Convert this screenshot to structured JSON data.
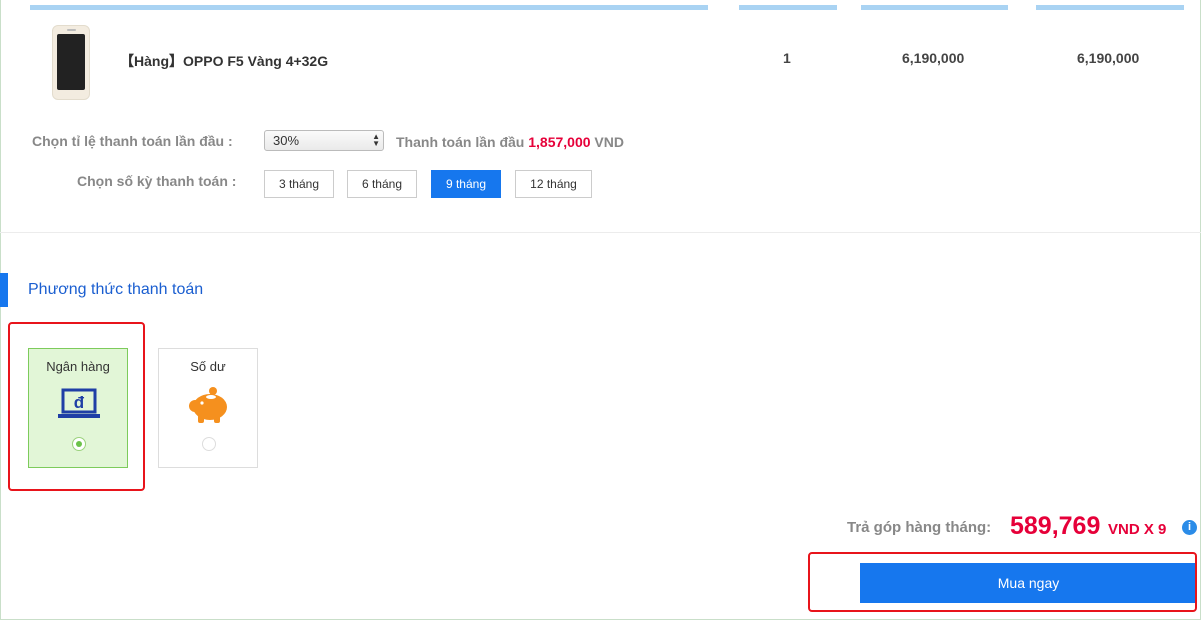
{
  "product": {
    "name": "【Hàng】OPPO F5 Vàng 4+32G",
    "quantity": "1",
    "unit_price": "6,190,000",
    "total": "6,190,000"
  },
  "installment": {
    "down_ratio_label": "Chọn tỉ lệ thanh toán lần đầu :",
    "down_ratio_value": "30%",
    "down_payment_label": "Thanh toán lần đầu",
    "down_payment_amount": "1,857,000",
    "down_payment_unit": "VND",
    "term_label": "Chọn số kỳ thanh toán :",
    "terms": [
      "3 tháng",
      "6 tháng",
      "9 tháng",
      "12 tháng"
    ],
    "selected_term": "9 tháng"
  },
  "payment": {
    "section_title": "Phương thức thanh toán",
    "methods": [
      {
        "label": "Ngân hàng",
        "icon": "bank-laptop-icon",
        "selected": true
      },
      {
        "label": "Số dư",
        "icon": "piggy-bank-icon",
        "selected": false
      }
    ]
  },
  "summary": {
    "monthly_label": "Trả góp hàng tháng:",
    "monthly_amount": "589,769",
    "monthly_unit": "VND X 9",
    "info_icon": "info-icon",
    "buy_label": "Mua ngay"
  },
  "colors": {
    "accent": "#1677ee",
    "price_red": "#e60039",
    "selected_bg": "#e2f6d7",
    "highlight_box": "#e8141b"
  }
}
